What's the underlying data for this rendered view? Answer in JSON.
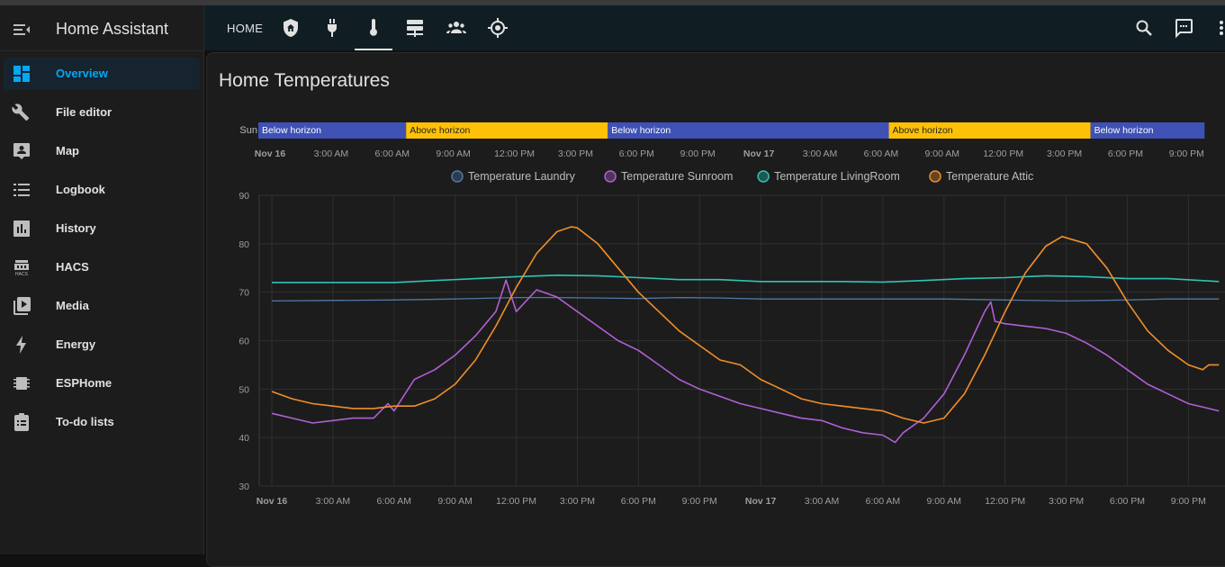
{
  "app": {
    "title": "Home Assistant"
  },
  "sidebar": {
    "items": [
      {
        "label": "Overview",
        "icon": "dashboard-icon",
        "active": true
      },
      {
        "label": "File editor",
        "icon": "wrench-icon"
      },
      {
        "label": "Map",
        "icon": "map-person-icon"
      },
      {
        "label": "Logbook",
        "icon": "list-icon"
      },
      {
        "label": "History",
        "icon": "chart-bar-icon"
      },
      {
        "label": "HACS",
        "icon": "hacs-icon"
      },
      {
        "label": "Media",
        "icon": "play-box-icon"
      },
      {
        "label": "Energy",
        "icon": "lightning-icon"
      },
      {
        "label": "ESPHome",
        "icon": "chip-icon"
      },
      {
        "label": "To-do lists",
        "icon": "clipboard-list-icon"
      }
    ]
  },
  "topbar": {
    "home_label": "HOME",
    "tabs": [
      "shield-home-icon",
      "plug-icon",
      "thermometer-icon",
      "server-icon",
      "account-group-icon",
      "crosshairs-gps-icon"
    ],
    "active_tab": "thermometer-icon",
    "actions": [
      "search-icon",
      "assist-icon",
      "more-icon"
    ]
  },
  "card": {
    "title": "Home Temperatures"
  },
  "timeline": {
    "entity_label": "Sun",
    "segments": [
      {
        "label": "Below horizon",
        "start": 0,
        "end": 7.3,
        "state": "below"
      },
      {
        "label": "Above horizon",
        "start": 7.3,
        "end": 17.2,
        "state": "above"
      },
      {
        "label": "Below horizon",
        "start": 17.2,
        "end": 31.0,
        "state": "below"
      },
      {
        "label": "Above horizon",
        "start": 31.0,
        "end": 40.9,
        "state": "above"
      },
      {
        "label": "Below horizon",
        "start": 40.9,
        "end": 46.5,
        "state": "below"
      }
    ],
    "colors": {
      "below": "#3f51b5",
      "above": "#ffc107"
    }
  },
  "x_axis": {
    "ticks": [
      {
        "t": 0,
        "label": "Nov 16",
        "bold": true
      },
      {
        "t": 3,
        "label": "3:00 AM"
      },
      {
        "t": 6,
        "label": "6:00 AM"
      },
      {
        "t": 9,
        "label": "9:00 AM"
      },
      {
        "t": 12,
        "label": "12:00 PM"
      },
      {
        "t": 15,
        "label": "3:00 PM"
      },
      {
        "t": 18,
        "label": "6:00 PM"
      },
      {
        "t": 21,
        "label": "9:00 PM"
      },
      {
        "t": 24,
        "label": "Nov 17",
        "bold": true
      },
      {
        "t": 27,
        "label": "3:00 AM"
      },
      {
        "t": 30,
        "label": "6:00 AM"
      },
      {
        "t": 33,
        "label": "9:00 AM"
      },
      {
        "t": 36,
        "label": "12:00 PM"
      },
      {
        "t": 39,
        "label": "3:00 PM"
      },
      {
        "t": 42,
        "label": "6:00 PM"
      },
      {
        "t": 45,
        "label": "9:00 PM"
      }
    ]
  },
  "chart_data": {
    "type": "line",
    "title": "Home Temperatures",
    "x_unit": "hours since Nov 16 00:00",
    "xlim": [
      0,
      46.5
    ],
    "ylim": [
      30,
      90
    ],
    "y_ticks": [
      30,
      40,
      50,
      60,
      70,
      80,
      90
    ],
    "grid": true,
    "legend_position": "top-center",
    "series": [
      {
        "name": "Temperature Laundry",
        "color": "#4e79a7",
        "points": [
          [
            0,
            68.2
          ],
          [
            3,
            68.3
          ],
          [
            6,
            68.4
          ],
          [
            9,
            68.6
          ],
          [
            12,
            68.9
          ],
          [
            14,
            68.9
          ],
          [
            16,
            68.8
          ],
          [
            18,
            68.7
          ],
          [
            20,
            68.9
          ],
          [
            22,
            68.8
          ],
          [
            24,
            68.6
          ],
          [
            27,
            68.6
          ],
          [
            30,
            68.6
          ],
          [
            33,
            68.6
          ],
          [
            36,
            68.4
          ],
          [
            39,
            68.2
          ],
          [
            42,
            68.4
          ],
          [
            44,
            68.6
          ],
          [
            46.5,
            68.6
          ]
        ]
      },
      {
        "name": "Temperature Sunroom",
        "color": "#b15fd4",
        "points": [
          [
            0,
            45
          ],
          [
            1,
            44
          ],
          [
            2,
            43
          ],
          [
            3,
            43.5
          ],
          [
            4,
            44
          ],
          [
            5,
            44
          ],
          [
            5.7,
            47
          ],
          [
            6,
            45.5
          ],
          [
            7,
            52
          ],
          [
            8,
            54
          ],
          [
            9,
            57
          ],
          [
            10,
            61
          ],
          [
            11,
            66
          ],
          [
            11.5,
            72.5
          ],
          [
            12,
            66
          ],
          [
            13,
            70.5
          ],
          [
            14,
            69
          ],
          [
            15,
            66
          ],
          [
            16,
            63
          ],
          [
            17,
            60
          ],
          [
            18,
            58
          ],
          [
            19,
            55
          ],
          [
            20,
            52
          ],
          [
            21,
            50
          ],
          [
            22,
            48.5
          ],
          [
            23,
            47
          ],
          [
            24,
            46
          ],
          [
            25,
            45
          ],
          [
            26,
            44
          ],
          [
            27,
            43.5
          ],
          [
            28,
            42
          ],
          [
            29,
            41
          ],
          [
            30,
            40.5
          ],
          [
            30.6,
            39
          ],
          [
            31,
            41
          ],
          [
            32,
            44
          ],
          [
            33,
            49
          ],
          [
            34,
            57
          ],
          [
            35,
            66
          ],
          [
            35.3,
            68
          ],
          [
            35.5,
            64
          ],
          [
            36,
            63.5
          ],
          [
            37,
            63
          ],
          [
            38,
            62.5
          ],
          [
            39,
            61.5
          ],
          [
            40,
            59.5
          ],
          [
            41,
            57
          ],
          [
            42,
            54
          ],
          [
            43,
            51
          ],
          [
            44,
            49
          ],
          [
            45,
            47
          ],
          [
            46,
            46
          ],
          [
            46.5,
            45.5
          ]
        ]
      },
      {
        "name": "Temperature LivingRoom",
        "color": "#2ec4b6",
        "points": [
          [
            0,
            72
          ],
          [
            3,
            72
          ],
          [
            6,
            72
          ],
          [
            8,
            72.4
          ],
          [
            10,
            72.8
          ],
          [
            12,
            73.2
          ],
          [
            14,
            73.5
          ],
          [
            16,
            73.4
          ],
          [
            18,
            73
          ],
          [
            20,
            72.6
          ],
          [
            22,
            72.6
          ],
          [
            24,
            72.2
          ],
          [
            26,
            72.2
          ],
          [
            28,
            72.2
          ],
          [
            30,
            72.1
          ],
          [
            32,
            72.4
          ],
          [
            34,
            72.8
          ],
          [
            36,
            73
          ],
          [
            38,
            73.4
          ],
          [
            40,
            73.2
          ],
          [
            42,
            72.8
          ],
          [
            44,
            72.8
          ],
          [
            46.5,
            72.2
          ]
        ]
      },
      {
        "name": "Temperature Attic",
        "color": "#f28e2b",
        "points": [
          [
            0,
            49.5
          ],
          [
            1,
            48
          ],
          [
            2,
            47
          ],
          [
            3,
            46.5
          ],
          [
            4,
            46
          ],
          [
            5,
            46
          ],
          [
            6,
            46.5
          ],
          [
            7,
            46.5
          ],
          [
            8,
            48
          ],
          [
            9,
            51
          ],
          [
            10,
            56
          ],
          [
            11,
            63
          ],
          [
            12,
            71
          ],
          [
            13,
            78
          ],
          [
            14,
            82.5
          ],
          [
            14.7,
            83.5
          ],
          [
            15,
            83.3
          ],
          [
            16,
            80
          ],
          [
            17,
            75
          ],
          [
            18,
            70
          ],
          [
            19,
            66
          ],
          [
            20,
            62
          ],
          [
            21,
            59
          ],
          [
            22,
            56
          ],
          [
            23,
            55
          ],
          [
            24,
            52
          ],
          [
            25,
            50
          ],
          [
            26,
            48
          ],
          [
            27,
            47
          ],
          [
            28,
            46.5
          ],
          [
            29,
            46
          ],
          [
            30,
            45.5
          ],
          [
            31,
            44
          ],
          [
            32,
            43
          ],
          [
            33,
            44
          ],
          [
            34,
            49
          ],
          [
            35,
            57
          ],
          [
            36,
            66
          ],
          [
            37,
            74
          ],
          [
            38,
            79.5
          ],
          [
            38.8,
            81.5
          ],
          [
            40,
            80
          ],
          [
            41,
            75
          ],
          [
            42,
            68
          ],
          [
            43,
            62
          ],
          [
            44,
            58
          ],
          [
            45,
            55
          ],
          [
            45.7,
            54
          ],
          [
            46,
            55
          ],
          [
            46.5,
            55
          ]
        ]
      }
    ]
  }
}
